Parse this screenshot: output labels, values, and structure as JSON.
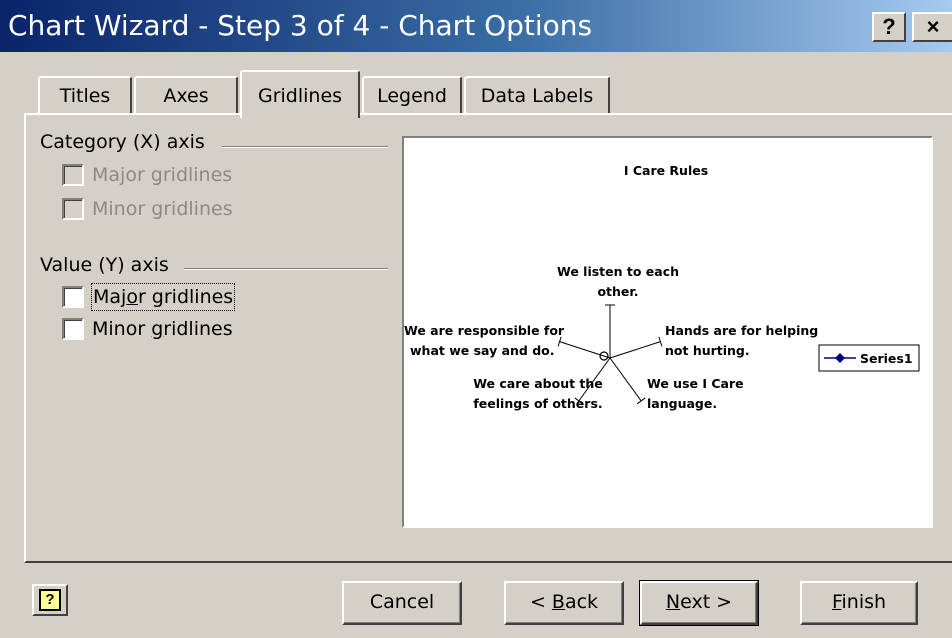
{
  "window": {
    "title": "Chart Wizard - Step 3 of 4 - Chart Options",
    "help_glyph": "?",
    "close_glyph": "×"
  },
  "tabs": [
    {
      "label": "Titles"
    },
    {
      "label": "Axes"
    },
    {
      "label": "Gridlines",
      "active": true
    },
    {
      "label": "Legend"
    },
    {
      "label": "Data Labels"
    }
  ],
  "category_axis": {
    "header": "Category (X) axis",
    "major": {
      "label": "Major gridlines",
      "checked": false,
      "enabled": false
    },
    "minor": {
      "label": "Minor gridlines",
      "checked": false,
      "enabled": false
    }
  },
  "value_axis": {
    "header": "Value (Y) axis",
    "major": {
      "label_pre": "Maj",
      "label_accel": "o",
      "label_post": "r gridlines",
      "checked": false,
      "enabled": true,
      "focused": true
    },
    "minor": {
      "label_pre": "Minor ",
      "label_accel": "g",
      "label_post": "ridlines",
      "checked": false,
      "enabled": true
    }
  },
  "preview": {
    "chart_data": {
      "type": "radar",
      "title": "I Care Rules",
      "categories": [
        "We listen to each other.",
        "Hands are for helping not hurting.",
        "We use I Care language.",
        "We care about the feelings of others.",
        "We are responsible for what we say and do."
      ],
      "label_lines": [
        [
          "We listen to each",
          "other."
        ],
        [
          "Hands are for helping",
          "not hurting."
        ],
        [
          "We use I Care",
          "language."
        ],
        [
          "We care about the",
          "feelings of others."
        ],
        [
          "We are responsible for",
          "what we say and do."
        ]
      ],
      "series": [
        {
          "name": "Series1",
          "values": [
            0,
            0,
            0,
            0,
            0
          ],
          "color": "#000080"
        }
      ],
      "legend": "right",
      "grid": false
    }
  },
  "buttons": {
    "help_glyph": "?",
    "cancel": "Cancel",
    "back_pre": "< ",
    "back_accel": "B",
    "back_post": "ack",
    "next_accel": "N",
    "next_post": "ext >",
    "finish_accel": "F",
    "finish_post": "inish"
  }
}
